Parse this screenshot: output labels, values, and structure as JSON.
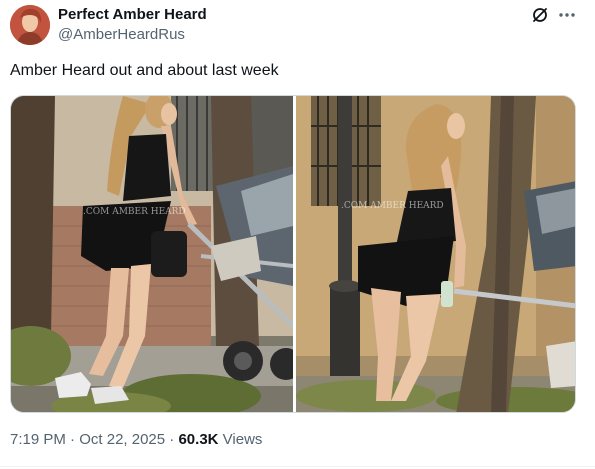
{
  "tweet": {
    "author": {
      "display_name": "Perfect Amber Heard",
      "handle": "@AmberHeardRus"
    },
    "text": "Amber Heard out and about last week",
    "time": "7:19 PM",
    "separator": "·",
    "date": "Oct 22, 2025",
    "views_count": "60.3K",
    "views_label": "Views"
  },
  "media": {
    "photo_count": 2,
    "watermark": ".COM AMBER HEARD"
  },
  "icons": {
    "grok": "grok-icon",
    "more": "more-horizontal-icon"
  },
  "colors": {
    "text_primary": "#0f1419",
    "text_secondary": "#536471",
    "border": "#cfd9de"
  }
}
